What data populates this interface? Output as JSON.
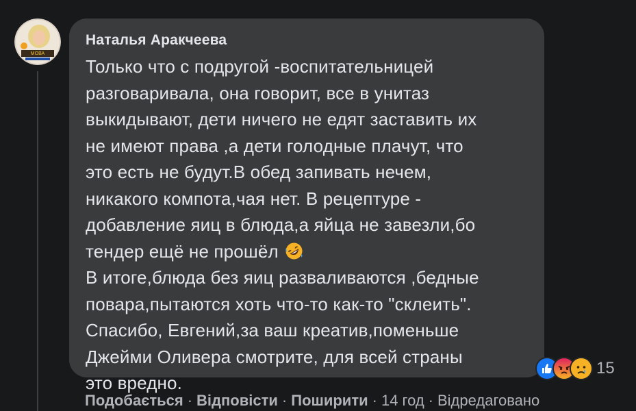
{
  "comment": {
    "author": "Наталья Аракчеева",
    "lines": [
      "Только что с подругой -воспитательницей",
      "разговаривала, она говорит, все в унитаз",
      "выкидывают, дети ничего не едят заставить их",
      "не имеют права ,а дети голодные плачут, что",
      "это есть не будут.В обед запивать нечем,",
      "никакого компота,чая нет. В рецептуре -",
      "добавление яиц в блюда,а яйца не завезли,бо",
      "тендер ещё не прошёл"
    ],
    "lines_after_emoji": [
      "В итоге,блюда без яиц разваливаются ,бедные",
      "повара,пытаются хоть что-то как-то \"склеить\".",
      "Спасибо, Евгений,за ваш креатив,поменьше",
      "Джейми Оливера смотрите, для всей страны",
      "это вредно."
    ],
    "inline_emoji": "rolling-on-floor-laughing-icon"
  },
  "reactions": {
    "icons": [
      "like-icon",
      "angry-icon",
      "sad-icon"
    ],
    "count": "15"
  },
  "actions": {
    "like": "Подобається",
    "reply": "Відповісти",
    "share": "Поширити",
    "time": "14 год",
    "edited": "Відредаговано",
    "separator": "·"
  },
  "colors": {
    "background": "#18191a",
    "bubble": "#3a3b3c",
    "text": "#e4e6eb",
    "secondary": "#b0b3b8",
    "like_blue": "#1877f2",
    "angry_red": "#e9710f",
    "sad_yellow": "#f7b125"
  }
}
